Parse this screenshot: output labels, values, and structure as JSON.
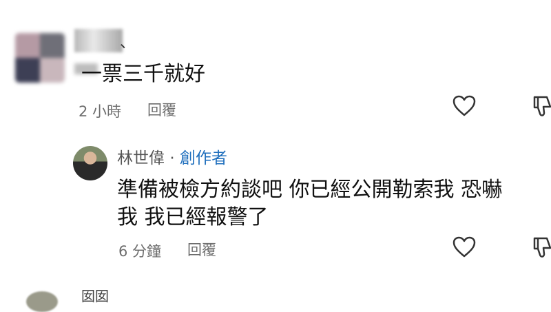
{
  "comment1": {
    "author_partial": "、",
    "text": "一票三千就好",
    "time": "2 小時",
    "reply_label": "回覆"
  },
  "comment2": {
    "author": "林世偉",
    "separator": "·",
    "badge": "創作者",
    "line1": "準備被檢方約談吧 你已經公開勒索我 恐嚇",
    "line2": "我 我已經報警了",
    "time": "6 分鐘",
    "reply_label": "回覆"
  },
  "comment3": {
    "author_partial": "囡囡"
  },
  "icons": {
    "like": "heart-outline-icon",
    "dislike": "thumbs-down-icon"
  },
  "colors": {
    "creator_badge": "#1f6fbd",
    "meta_text": "#6d6d6d"
  }
}
